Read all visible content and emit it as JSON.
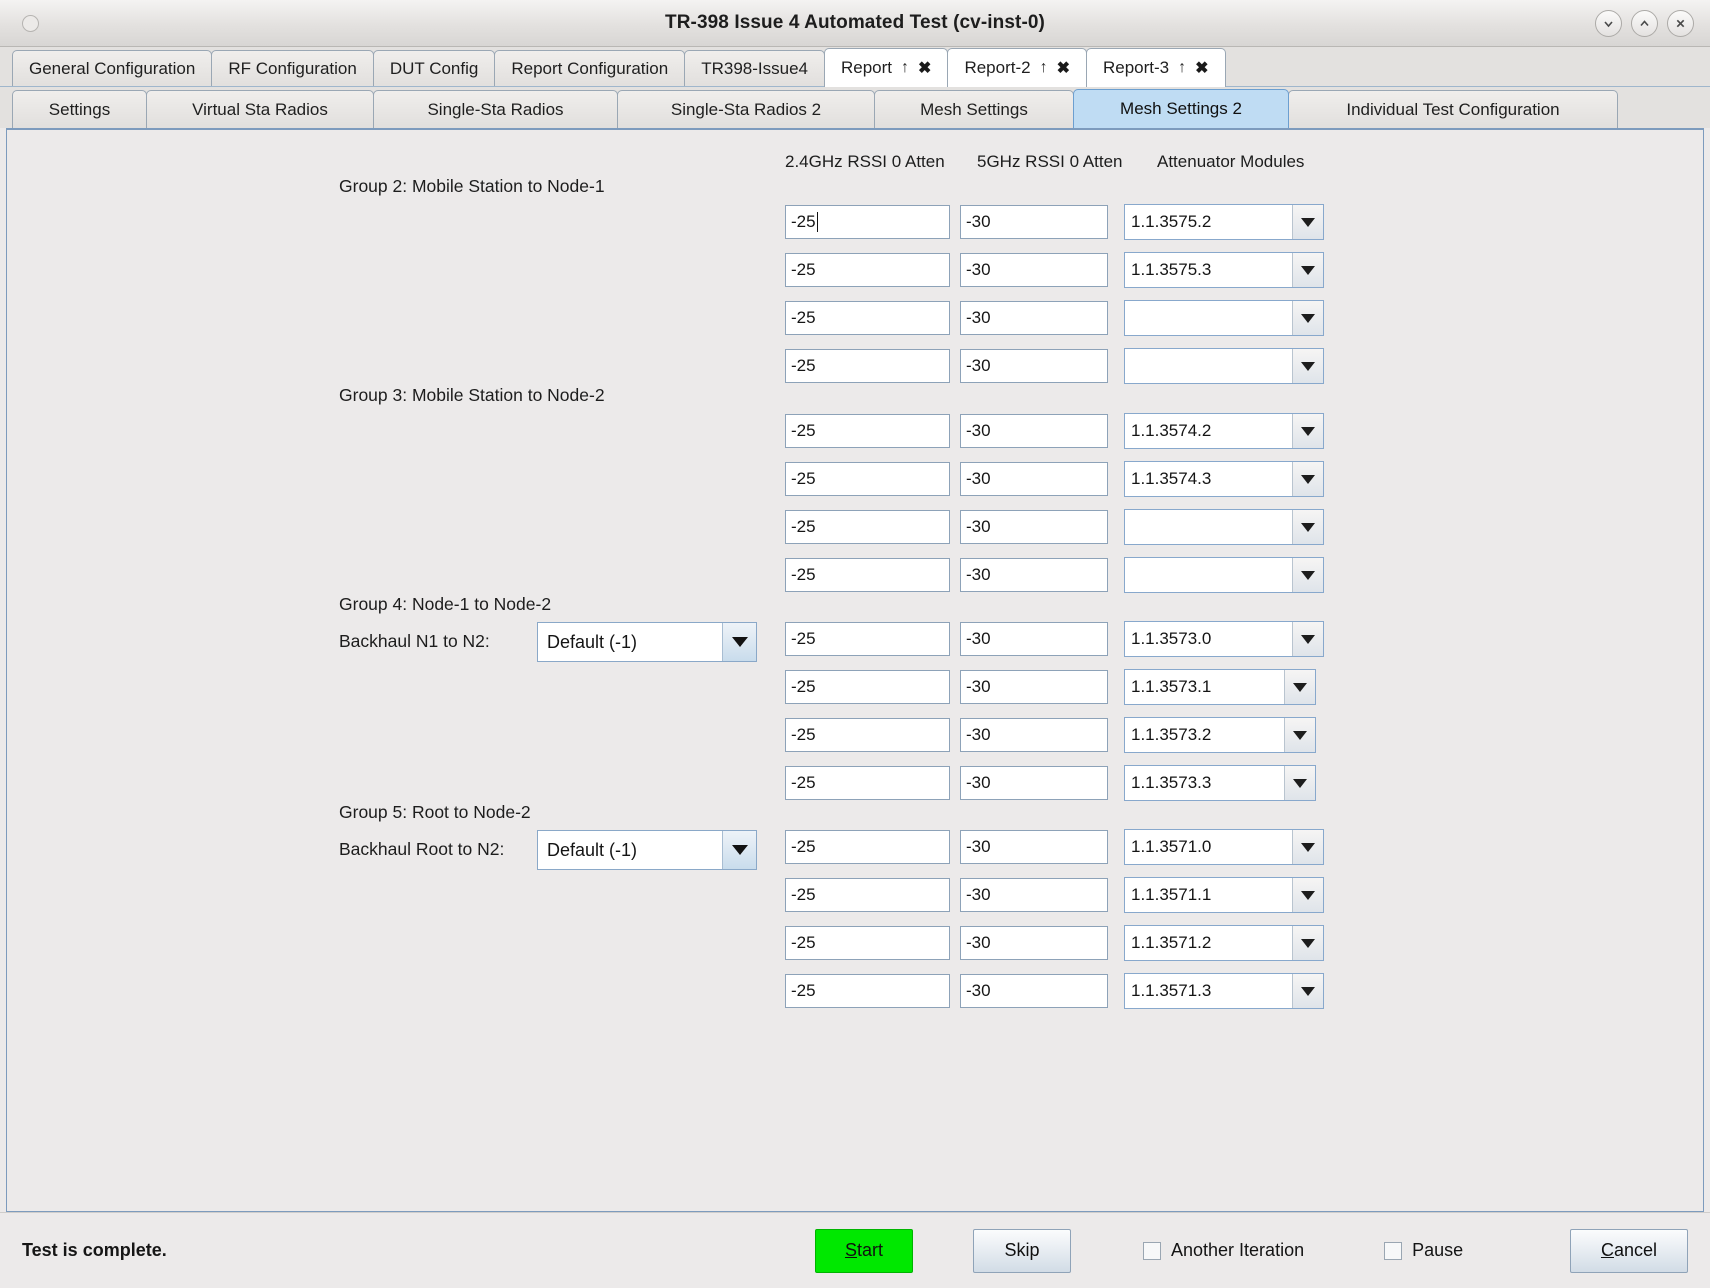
{
  "window": {
    "title": "TR-398 Issue 4 Automated Test  (cv-inst-0)",
    "controls": [
      {
        "name": "minimize",
        "glyph": "chevron-down"
      },
      {
        "name": "maximize",
        "glyph": "chevron-up"
      },
      {
        "name": "close",
        "glyph": "x"
      }
    ]
  },
  "tabs_row1": [
    {
      "label": "General Configuration",
      "closable": false,
      "active": false
    },
    {
      "label": "RF Configuration",
      "closable": false,
      "active": false
    },
    {
      "label": "DUT Config",
      "closable": false,
      "active": false
    },
    {
      "label": "Report Configuration",
      "closable": false,
      "active": false
    },
    {
      "label": "TR398-Issue4",
      "closable": false,
      "active": false
    },
    {
      "label": "Report",
      "closable": true,
      "active": false,
      "up": "↑",
      "close": "✖"
    },
    {
      "label": "Report-2",
      "closable": true,
      "active": false,
      "up": "↑",
      "close": "✖"
    },
    {
      "label": "Report-3",
      "closable": true,
      "active": false,
      "up": "↑",
      "close": "✖"
    }
  ],
  "tabs_row2": [
    {
      "label": "Settings",
      "active": false
    },
    {
      "label": "Virtual Sta Radios",
      "active": false
    },
    {
      "label": "Single-Sta Radios",
      "active": false
    },
    {
      "label": "Single-Sta Radios 2",
      "active": false
    },
    {
      "label": "Mesh Settings",
      "active": false
    },
    {
      "label": "Mesh Settings 2",
      "active": true
    },
    {
      "label": "Individual Test Configuration",
      "active": false
    }
  ],
  "column_headers": {
    "rssi_24": "2.4GHz RSSI 0 Atten",
    "rssi_5": "5GHz RSSI 0 Atten",
    "attenuator": "Attenuator Modules"
  },
  "groups": [
    {
      "id": "group2",
      "label": "Group 2: Mobile Station to Node-1",
      "backhaul": null,
      "rows": [
        {
          "rssi24": "-25",
          "rssi5": "-30",
          "module": "1.1.3575.2",
          "focused": true
        },
        {
          "rssi24": "-25",
          "rssi5": "-30",
          "module": "1.1.3575.3",
          "focused": false
        },
        {
          "rssi24": "-25",
          "rssi5": "-30",
          "module": "",
          "focused": false
        },
        {
          "rssi24": "-25",
          "rssi5": "-30",
          "module": "",
          "focused": false
        }
      ]
    },
    {
      "id": "group3",
      "label": "Group 3: Mobile Station to Node-2",
      "backhaul": null,
      "rows": [
        {
          "rssi24": "-25",
          "rssi5": "-30",
          "module": "1.1.3574.2",
          "focused": false
        },
        {
          "rssi24": "-25",
          "rssi5": "-30",
          "module": "1.1.3574.3",
          "focused": false
        },
        {
          "rssi24": "-25",
          "rssi5": "-30",
          "module": "",
          "focused": false
        },
        {
          "rssi24": "-25",
          "rssi5": "-30",
          "module": "",
          "focused": false
        }
      ]
    },
    {
      "id": "group4",
      "label": "Group 4: Node-1 to Node-2",
      "backhaul": {
        "label": "Backhaul N1 to N2:",
        "value": "Default (-1)"
      },
      "rows": [
        {
          "rssi24": "-25",
          "rssi5": "-30",
          "module": "1.1.3573.0",
          "focused": false
        },
        {
          "rssi24": "-25",
          "rssi5": "-30",
          "module": "1.1.3573.1",
          "focused": false
        },
        {
          "rssi24": "-25",
          "rssi5": "-30",
          "module": "1.1.3573.2",
          "focused": false
        },
        {
          "rssi24": "-25",
          "rssi5": "-30",
          "module": "1.1.3573.3",
          "focused": false
        }
      ]
    },
    {
      "id": "group5",
      "label": "Group 5: Root to Node-2",
      "backhaul": {
        "label": "Backhaul Root to N2:",
        "value": "Default (-1)"
      },
      "rows": [
        {
          "rssi24": "-25",
          "rssi5": "-30",
          "module": "1.1.3571.0",
          "focused": false
        },
        {
          "rssi24": "-25",
          "rssi5": "-30",
          "module": "1.1.3571.1",
          "focused": false
        },
        {
          "rssi24": "-25",
          "rssi5": "-30",
          "module": "1.1.3571.2",
          "focused": false
        },
        {
          "rssi24": "-25",
          "rssi5": "-30",
          "module": "1.1.3571.3",
          "focused": false
        }
      ]
    }
  ],
  "statusbar": {
    "status": "Test is complete.",
    "start_label": "Start",
    "skip_label": "Skip",
    "another_iteration_label": "Another Iteration",
    "another_iteration_checked": false,
    "pause_label": "Pause",
    "pause_checked": false,
    "cancel_label": "Cancel"
  },
  "colors": {
    "start_green": "#00e800",
    "active_tab_blue": "#bfdcf3",
    "panel_bg": "#eceaea"
  }
}
